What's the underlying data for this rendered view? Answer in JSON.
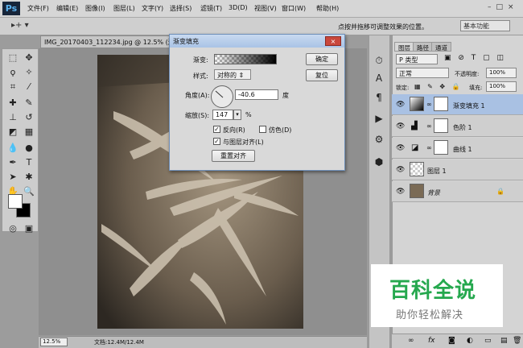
{
  "app": {
    "logo": "Ps"
  },
  "menus": [
    "文件(F)",
    "编辑(E)",
    "图像(I)",
    "图层(L)",
    "文字(Y)",
    "选择(S)",
    "滤镜(T)",
    "3D(D)",
    "视图(V)",
    "窗口(W)",
    "帮助(H)"
  ],
  "window_buttons": {
    "minimize": "–",
    "restore": "□",
    "close": "×"
  },
  "options_bar": {
    "tool_glyph": "▸+ ▾",
    "hint": "点按并拖移可调整效果的位置。",
    "workspace": "基本功能"
  },
  "document": {
    "tab_label": "IMG_20170403_112234.jpg @ 12.5% (渐变"
  },
  "status": {
    "zoom": "12.5%",
    "doc_size": "文档:12.4M/12.4M"
  },
  "dialog": {
    "title": "渐变填充",
    "gradient_label": "渐变:",
    "style_label": "样式:",
    "style_value": "对称的",
    "angle_label": "角度(A):",
    "angle_value": "-40.6",
    "angle_unit": "度",
    "scale_label": "缩放(S):",
    "scale_value": "147",
    "scale_unit": "%",
    "reverse_label": "反向(R)",
    "reverse_checked": true,
    "dither_label": "仿色(D)",
    "dither_checked": false,
    "align_label": "与图层对齐(L)",
    "align_checked": true,
    "reset_align_label": "重置对齐",
    "ok_label": "确定",
    "reset_label": "复位",
    "close_glyph": "×"
  },
  "layers_panel": {
    "tabs": [
      "图层",
      "路径",
      "通道"
    ],
    "filter_label": "P 类型",
    "blend_mode": "正常",
    "opacity_label": "不透明度:",
    "opacity_value": "100%",
    "lock_label": "锁定:",
    "fill_label": "填充:",
    "fill_value": "100%",
    "layers": [
      {
        "name": "渐变填充 1",
        "selected": true
      },
      {
        "name": "色阶 1",
        "selected": false
      },
      {
        "name": "曲线 1",
        "selected": false
      },
      {
        "name": "图层 1",
        "selected": false
      },
      {
        "name": "背景",
        "selected": false
      }
    ]
  },
  "watermark": {
    "main": "百科全说",
    "sub": "助你轻松解决"
  },
  "colors": {
    "menubar": "#d6d6d6",
    "selected_layer": "#a9c1e3",
    "watermark_green": "#25a84e"
  }
}
